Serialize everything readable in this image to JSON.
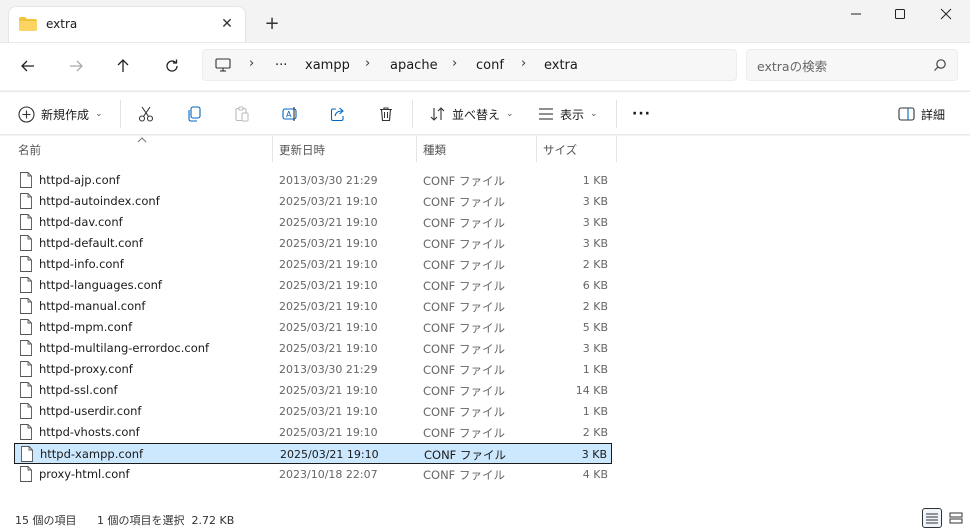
{
  "tab": {
    "title": "extra"
  },
  "address": {
    "crumbs": [
      "xampp",
      "apache",
      "conf",
      "extra"
    ],
    "overflow": "···"
  },
  "search": {
    "placeholder": "extraの検索"
  },
  "toolbar": {
    "new_label": "新規作成",
    "sort_label": "並べ替え",
    "view_label": "表示",
    "more_label": "···",
    "details_label": "詳細"
  },
  "columns": {
    "name": "名前",
    "date": "更新日時",
    "type": "種類",
    "size": "サイズ"
  },
  "files": [
    {
      "name": "httpd-ajp.conf",
      "date": "2013/03/30 21:29",
      "type": "CONF ファイル",
      "size": "1 KB"
    },
    {
      "name": "httpd-autoindex.conf",
      "date": "2025/03/21 19:10",
      "type": "CONF ファイル",
      "size": "3 KB"
    },
    {
      "name": "httpd-dav.conf",
      "date": "2025/03/21 19:10",
      "type": "CONF ファイル",
      "size": "3 KB"
    },
    {
      "name": "httpd-default.conf",
      "date": "2025/03/21 19:10",
      "type": "CONF ファイル",
      "size": "3 KB"
    },
    {
      "name": "httpd-info.conf",
      "date": "2025/03/21 19:10",
      "type": "CONF ファイル",
      "size": "2 KB"
    },
    {
      "name": "httpd-languages.conf",
      "date": "2025/03/21 19:10",
      "type": "CONF ファイル",
      "size": "6 KB"
    },
    {
      "name": "httpd-manual.conf",
      "date": "2025/03/21 19:10",
      "type": "CONF ファイル",
      "size": "2 KB"
    },
    {
      "name": "httpd-mpm.conf",
      "date": "2025/03/21 19:10",
      "type": "CONF ファイル",
      "size": "5 KB"
    },
    {
      "name": "httpd-multilang-errordoc.conf",
      "date": "2025/03/21 19:10",
      "type": "CONF ファイル",
      "size": "3 KB"
    },
    {
      "name": "httpd-proxy.conf",
      "date": "2013/03/30 21:29",
      "type": "CONF ファイル",
      "size": "1 KB"
    },
    {
      "name": "httpd-ssl.conf",
      "date": "2025/03/21 19:10",
      "type": "CONF ファイル",
      "size": "14 KB"
    },
    {
      "name": "httpd-userdir.conf",
      "date": "2025/03/21 19:10",
      "type": "CONF ファイル",
      "size": "1 KB"
    },
    {
      "name": "httpd-vhosts.conf",
      "date": "2025/03/21 19:10",
      "type": "CONF ファイル",
      "size": "2 KB"
    },
    {
      "name": "httpd-xampp.conf",
      "date": "2025/03/21 19:10",
      "type": "CONF ファイル",
      "size": "3 KB",
      "selected": true
    },
    {
      "name": "proxy-html.conf",
      "date": "2023/10/18 22:07",
      "type": "CONF ファイル",
      "size": "4 KB"
    }
  ],
  "status": {
    "item_count": "15 個の項目",
    "selection": "1 個の項目を選択  2.72 KB"
  },
  "colors": {
    "folder": "#f3c13a",
    "selection_bg": "#cce8ff",
    "accent": "#0067c0"
  },
  "icons": [
    "folder-icon",
    "close-icon",
    "plus-icon",
    "minimize-icon",
    "maximize-icon",
    "window-close-icon",
    "back-icon",
    "forward-icon",
    "up-icon",
    "refresh-icon",
    "monitor-icon",
    "search-icon",
    "new-icon",
    "cut-icon",
    "copy-icon",
    "paste-icon",
    "rename-icon",
    "share-icon",
    "delete-icon",
    "sort-icon",
    "view-icon",
    "more-icon",
    "details-pane-icon",
    "file-icon",
    "details-view-icon",
    "tiles-view-icon"
  ]
}
